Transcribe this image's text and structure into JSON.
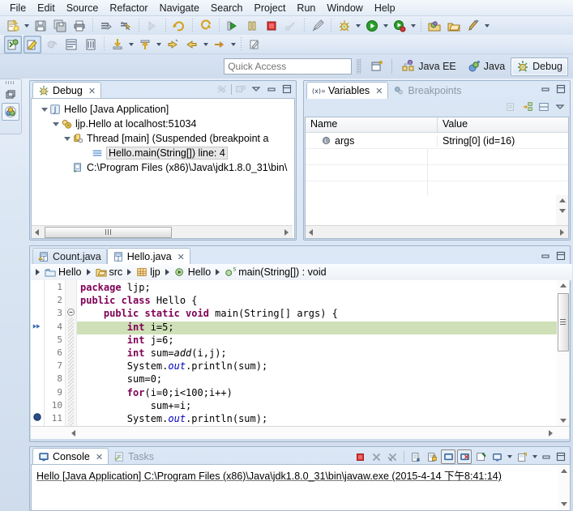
{
  "window": {
    "title": "Eclipse - Debug"
  },
  "menu": {
    "items": [
      {
        "label": "File"
      },
      {
        "label": "Edit"
      },
      {
        "label": "Source"
      },
      {
        "label": "Refactor"
      },
      {
        "label": "Navigate"
      },
      {
        "label": "Search"
      },
      {
        "label": "Project"
      },
      {
        "label": "Run"
      },
      {
        "label": "Window"
      },
      {
        "label": "Help"
      }
    ]
  },
  "toolbar_row1": {
    "items": [
      {
        "name": "new-wizard-icon",
        "arrow": true
      },
      {
        "name": "save-icon",
        "arrow": false
      },
      {
        "name": "save-all-icon",
        "arrow": false
      },
      {
        "name": "print-icon",
        "arrow": false
      },
      {
        "sep": true
      },
      {
        "name": "build-all-icon",
        "arrow": false
      },
      {
        "name": "skip-breakpoints-icon",
        "arrow": false
      },
      {
        "sep": true
      },
      {
        "name": "resume-icon",
        "arrow": false
      },
      {
        "sep": true
      },
      {
        "name": "suspend-icon",
        "arrow": false
      },
      {
        "sep": true
      },
      {
        "name": "step-into-group-icon",
        "arrow": false
      },
      {
        "name": "pause-icon",
        "arrow": false
      },
      {
        "name": "terminate-icon",
        "arrow": false
      },
      {
        "name": "disconnect-icon",
        "arrow": false
      },
      {
        "sep": true
      },
      {
        "name": "pencil-disabled-icon",
        "arrow": false
      },
      {
        "sep": true
      },
      {
        "name": "debug-icon",
        "arrow": true
      },
      {
        "name": "run-icon",
        "arrow": true
      },
      {
        "name": "external-tools-icon",
        "arrow": true
      },
      {
        "sep": true
      },
      {
        "name": "open-type-icon",
        "arrow": false
      },
      {
        "name": "open-resource-icon",
        "arrow": false
      },
      {
        "name": "search-icon",
        "arrow": true
      }
    ]
  },
  "toolbar_row2": {
    "items": [
      {
        "name": "new-java-project-icon",
        "pressed": true
      },
      {
        "name": "new-java-class-icon",
        "pressed": true
      },
      {
        "name": "toggle-breakpoint-icon"
      },
      {
        "name": "open-declaration-icon"
      },
      {
        "name": "toggle-mark-occurrences-icon"
      },
      {
        "sep": true
      },
      {
        "name": "step-into-icon",
        "arrow": true
      },
      {
        "name": "step-return-icon",
        "arrow": true
      },
      {
        "name": "next-annotation-icon"
      },
      {
        "name": "previous-annotation-icon",
        "arrow": true
      },
      {
        "name": "last-edit-location-icon",
        "arrow": true
      },
      {
        "sep": true
      },
      {
        "name": "link-editor-icon"
      }
    ]
  },
  "quick_access": {
    "placeholder": "Quick Access",
    "value": "",
    "new-perspective-icon": "new-perspective-icon",
    "perspectives": [
      {
        "label": "Java EE",
        "icon": "java-ee-perspective-icon",
        "active": false
      },
      {
        "label": "Java",
        "icon": "java-perspective-icon",
        "active": false
      },
      {
        "label": "Debug",
        "icon": "debug-perspective-icon",
        "active": true
      }
    ]
  },
  "rail": {
    "items": [
      {
        "name": "restore-icon"
      },
      {
        "name": "debug-view-icon",
        "selected": true
      }
    ]
  },
  "debug_view": {
    "tab_label": "Debug",
    "tab_icon": "debug-perspective-icon",
    "close_label": "✕",
    "tools": [
      {
        "name": "disconnect-disabled-icon"
      },
      {
        "name": "debug-view-menu-icon"
      },
      {
        "name": "view-menu-icon"
      },
      {
        "name": "minimize-icon"
      },
      {
        "name": "maximize-icon"
      }
    ],
    "tree": [
      {
        "label": "Hello [Java Application]",
        "icon": "java-launch-icon",
        "indent": 0,
        "expanded": true,
        "selected": false
      },
      {
        "label": "ljp.Hello at localhost:51034",
        "icon": "debug-target-icon",
        "indent": 1,
        "expanded": true,
        "selected": false
      },
      {
        "label": "Thread [main] (Suspended (breakpoint a",
        "icon": "thread-suspended-icon",
        "indent": 2,
        "expanded": true,
        "selected": false
      },
      {
        "label": "Hello.main(String[]) line: 4",
        "icon": "stack-frame-icon",
        "indent": 3,
        "expanded": false,
        "selected": true
      },
      {
        "label": "C:\\Program Files (x86)\\Java\\jdk1.8.0_31\\bin\\",
        "icon": "jvm-process-icon",
        "indent": 2,
        "expanded": false,
        "selected": false
      }
    ]
  },
  "variables_view": {
    "tabs": [
      {
        "label": "Variables",
        "icon": "variables-icon",
        "active": true,
        "close_label": "✕"
      },
      {
        "label": "Breakpoints",
        "icon": "breakpoints-icon",
        "active": false,
        "close_label": ""
      }
    ],
    "tools": [
      {
        "name": "minimize-icon"
      },
      {
        "name": "maximize-icon"
      }
    ],
    "inner_tools": [
      {
        "name": "collapse-all-icon"
      },
      {
        "name": "show-logical-structure-icon"
      },
      {
        "name": "horizontal-layout-icon"
      },
      {
        "name": "view-menu-icon"
      }
    ],
    "columns": [
      "Name",
      "Value"
    ],
    "rows": [
      {
        "name": "args",
        "value": "String[0]  (id=16)",
        "icon": "local-variable-icon"
      }
    ]
  },
  "editor": {
    "tabs": [
      {
        "label": "Count.java",
        "icon": "java-file-warning-icon",
        "active": false,
        "close_label": ""
      },
      {
        "label": "Hello.java",
        "icon": "java-file-icon",
        "active": true,
        "close_label": "✕"
      }
    ],
    "tools": [
      {
        "name": "minimize-icon"
      },
      {
        "name": "maximize-icon"
      }
    ],
    "breadcrumb": [
      {
        "label": "Hello",
        "icon": "project-icon"
      },
      {
        "label": "src",
        "icon": "source-folder-icon"
      },
      {
        "label": "ljp",
        "icon": "package-icon"
      },
      {
        "label": "Hello",
        "icon": "class-runnable-icon"
      },
      {
        "label": "main(String[]) : void",
        "icon": "method-static-icon"
      }
    ],
    "lines": [
      {
        "num": "1",
        "text": "package ljp;",
        "highlight": false,
        "folding": "",
        "marker": ""
      },
      {
        "num": "2",
        "text": "public class Hello {",
        "highlight": false,
        "folding": "",
        "marker": ""
      },
      {
        "num": "3",
        "text": "    public static void main(String[] args) {",
        "highlight": false,
        "folding": "collapse",
        "marker": ""
      },
      {
        "num": "4",
        "text": "        int i=5;",
        "highlight": true,
        "folding": "bar",
        "marker": "current-instruction-pointer"
      },
      {
        "num": "5",
        "text": "        int j=6;",
        "highlight": false,
        "folding": "bar",
        "marker": ""
      },
      {
        "num": "6",
        "text": "        int sum=add(i,j);",
        "highlight": false,
        "folding": "bar",
        "marker": ""
      },
      {
        "num": "7",
        "text": "        System.out.println(sum);",
        "highlight": false,
        "folding": "bar",
        "marker": ""
      },
      {
        "num": "8",
        "text": "        sum=0;",
        "highlight": false,
        "folding": "bar",
        "marker": ""
      },
      {
        "num": "9",
        "text": "        for(i=0;i<100;i++)",
        "highlight": false,
        "folding": "bar",
        "marker": ""
      },
      {
        "num": "10",
        "text": "            sum+=i;",
        "highlight": false,
        "folding": "bar",
        "marker": ""
      },
      {
        "num": "11",
        "text": "        System.out.println(sum);",
        "highlight": false,
        "folding": "bar",
        "marker": "breakpoint"
      }
    ]
  },
  "console_view": {
    "tabs": [
      {
        "label": "Console",
        "icon": "console-icon",
        "active": true,
        "close_label": "✕"
      },
      {
        "label": "Tasks",
        "icon": "tasks-icon",
        "active": false,
        "close_label": ""
      }
    ],
    "tools": [
      {
        "name": "terminate-icon"
      },
      {
        "name": "remove-launch-icon"
      },
      {
        "name": "remove-all-terminated-icon"
      },
      {
        "sep": true
      },
      {
        "name": "clear-console-icon"
      },
      {
        "name": "scroll-lock-icon"
      },
      {
        "name": "show-console-on-output-icon",
        "framed": true
      },
      {
        "name": "show-console-on-error-icon",
        "framed": true
      },
      {
        "sep": false
      },
      {
        "name": "pin-console-icon"
      },
      {
        "name": "display-selected-console-icon",
        "arrow": true
      },
      {
        "name": "open-console-icon",
        "arrow": true
      },
      {
        "name": "minimize-icon"
      },
      {
        "name": "maximize-icon"
      }
    ],
    "output": "Hello [Java Application] C:\\Program Files (x86)\\Java\\jdk1.8.0_31\\bin\\javaw.exe (2015-4-14 下午8:41:14)"
  },
  "colors": {
    "keyword": "#7f0055",
    "string": "#2a00ff",
    "current_line_highlight": "#cfe0b8",
    "selection": "#d7e6f4",
    "accent": "#4a7ab5"
  }
}
